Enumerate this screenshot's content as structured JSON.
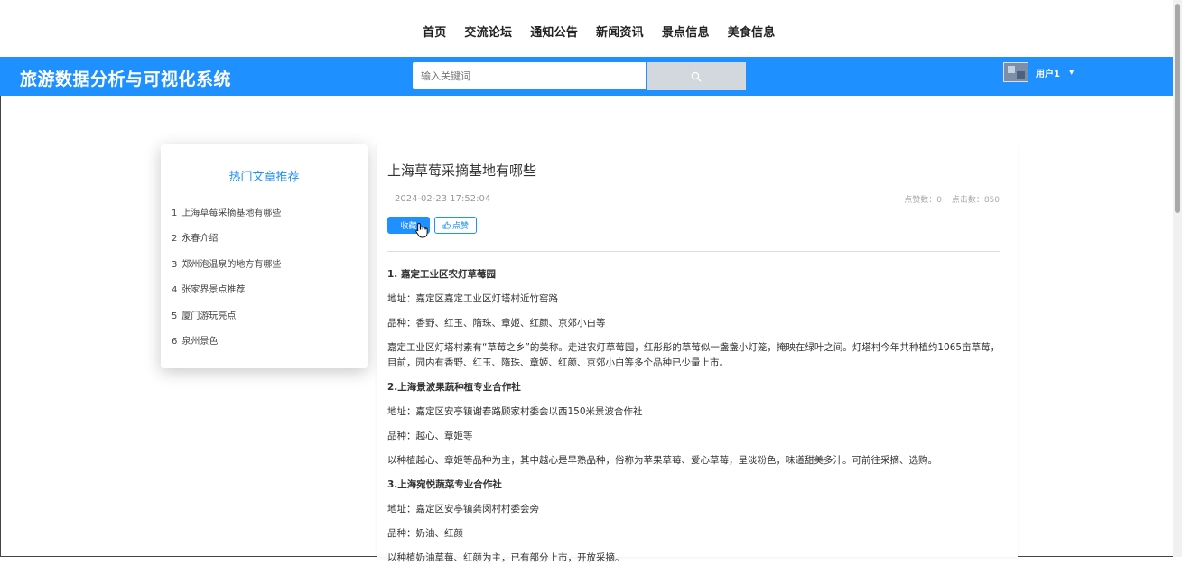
{
  "nav": {
    "items": [
      "首页",
      "交流论坛",
      "通知公告",
      "新闻资讯",
      "景点信息",
      "美食信息"
    ]
  },
  "header": {
    "brand": "旅游数据分析与可视化系统",
    "search_placeholder": "输入关键词",
    "user_name": "用户1"
  },
  "sidebar": {
    "title": "热门文章推荐",
    "items": [
      {
        "num": "1",
        "label": "上海草莓采摘基地有哪些"
      },
      {
        "num": "2",
        "label": "永春介绍"
      },
      {
        "num": "3",
        "label": "郑州泡温泉的地方有哪些"
      },
      {
        "num": "4",
        "label": "张家界景点推荐"
      },
      {
        "num": "5",
        "label": "厦门游玩亮点"
      },
      {
        "num": "6",
        "label": "泉州景色"
      }
    ]
  },
  "article": {
    "title": "上海草莓采摘基地有哪些",
    "date": "2024-02-23 17:52:04",
    "likes": "点赞数：0",
    "clicks": "点击数：850",
    "fav_label": "收藏",
    "like_label": "点赞",
    "paragraphs": [
      {
        "text": "1. 嘉定工业区农灯草莓园",
        "heading": true
      },
      {
        "text": "地址：嘉定区嘉定工业区灯塔村近竹窑路",
        "heading": false
      },
      {
        "text": "品种：香野、红玉、隋珠、章姬、红颜、京郊小白等",
        "heading": false
      },
      {
        "text": "嘉定工业区灯塔村素有“草莓之乡”的美称。走进农灯草莓园，红彤彤的草莓似一盏盏小灯笼，掩映在绿叶之间。灯塔村今年共种植约1065亩草莓，目前，园内有香野、红玉、隋珠、章姬、红颜、京郊小白等多个品种已少量上市。",
        "heading": false
      },
      {
        "text": "2.上海景波果蔬种植专业合作社",
        "heading": true
      },
      {
        "text": "地址：嘉定区安亭镇谢春路顾家村委会以西150米景波合作社",
        "heading": false
      },
      {
        "text": "品种：越心、章姬等",
        "heading": false
      },
      {
        "text": "以种植越心、章姬等品种为主，其中越心是早熟品种，俗称为苹果草莓、爱心草莓，呈淡粉色，味道甜美多汁。可前往采摘、选购。",
        "heading": false
      },
      {
        "text": "3.上海宛悦蔬菜专业合作社",
        "heading": true
      },
      {
        "text": "地址：嘉定区安亭镇龚闵村村委会旁",
        "heading": false
      },
      {
        "text": "品种：奶油、红颜",
        "heading": false
      },
      {
        "text": "以种植奶油草莓、红颜为主，已有部分上市，开放采摘。",
        "heading": false
      }
    ]
  },
  "colors": {
    "accent": "#1e90ff",
    "search_button": "#d3d8de"
  },
  "icons": {
    "search": "search-icon",
    "like": "thumbs-up-icon",
    "caret": "chevron-down-icon"
  }
}
